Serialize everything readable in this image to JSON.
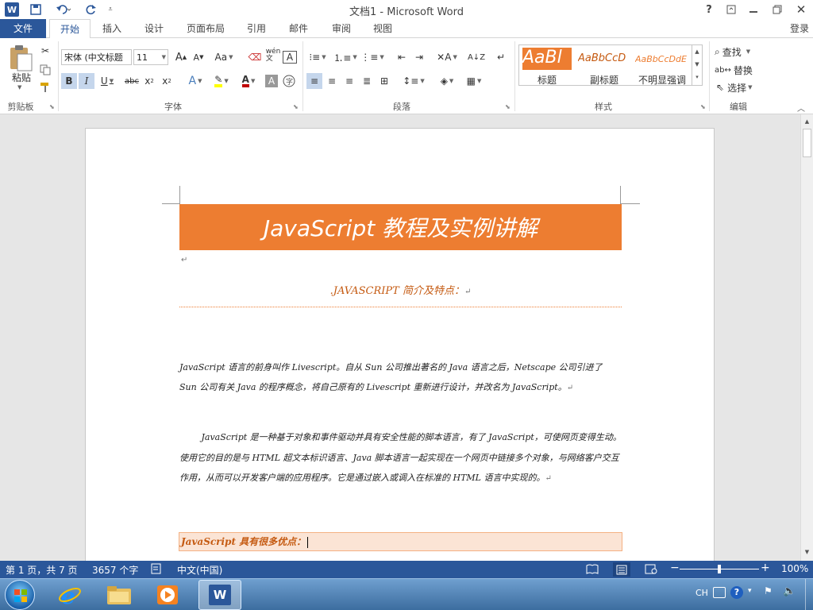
{
  "window": {
    "title": "文档1 - Microsoft Word",
    "app_icon": "W",
    "controls": [
      "?",
      "restore-ribbon",
      "minimize",
      "restore",
      "close"
    ]
  },
  "tabs": {
    "file": "文件",
    "items": [
      "开始",
      "插入",
      "设计",
      "页面布局",
      "引用",
      "邮件",
      "审阅",
      "视图"
    ],
    "login": "登录"
  },
  "ribbon": {
    "clipboard": {
      "paste": "粘贴",
      "label": "剪贴板"
    },
    "font": {
      "name": "宋体 (中文标题",
      "size": "11",
      "label": "字体",
      "text_color": "#c00000",
      "highlight": "#ffff00"
    },
    "paragraph": {
      "label": "段落"
    },
    "styles": {
      "label": "样式",
      "items": [
        {
          "preview": "AaBl",
          "name": "标题"
        },
        {
          "preview": "AaBbCcD",
          "name": "副标题"
        },
        {
          "preview": "AaBbCcDdE",
          "name": "不明显强调"
        }
      ]
    },
    "editing": {
      "label": "编辑",
      "find": "查找",
      "replace": "替换",
      "select": "选择"
    }
  },
  "document": {
    "title": "JavaScript 教程及实例讲解",
    "title_bg": "#ed7d31",
    "subtitle": ".JAVASCRIPT 简介及特点：",
    "subtitle_color": "#c55a11",
    "para1": "JavaScript 语言的前身叫作 Livescript。自从 Sun 公司推出著名的 Java 语言之后，Netscape 公司引进了 Sun 公司有关 Java 的程序概念，将自己原有的 Livescript  重新进行设计，并改名为 JavaScript。",
    "para2": "JavaScript 是一种基于对象和事件驱动并具有安全性能的脚本语言，有了 JavaScript，可使网页变得生动。使用它的目的是与 HTML 超文本标识语言、Java  脚本语言一起实现在一个网页中链接多个对象，与网络客户交互作用，从而可以开发客户端的应用程序。它是通过嵌入或调入在标准的 HTML 语言中实现的。",
    "heading2": "JavaScript 具有很多优点：",
    "heading2_bg": "#fbe4d5",
    "heading2_color": "#c55a11",
    "para_mark": "↵"
  },
  "status": {
    "page": "第 1 页，共 7 页",
    "words": "3657 个字",
    "language": "中文(中国)",
    "zoom": "100%",
    "zoom_level": 1.0
  },
  "taskbar": {
    "lang": "CH",
    "apps": [
      "start",
      "internet-explorer",
      "file-explorer",
      "media-player",
      "word"
    ]
  },
  "colors": {
    "accent": "#2b579a"
  }
}
